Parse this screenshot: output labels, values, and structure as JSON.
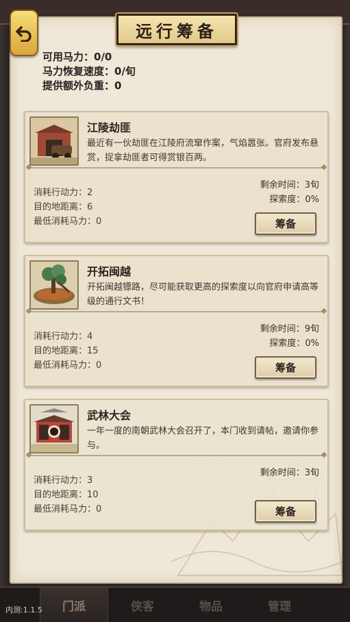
{
  "header": {
    "title": "远行筹备"
  },
  "stats": {
    "available_power": "可用马力：0/0",
    "recovery_speed": "马力恢复速度：0/旬",
    "extra_load": "提供额外负重：0"
  },
  "missions": [
    {
      "name": "江陵劫匪",
      "desc": "最近有一伙劫匪在江陵府流窜作案，气焰嚣张。官府发布悬赏，捉拿劫匪者可得赏银百两。",
      "action_cost": "消耗行动力：2",
      "distance": "目的地距离：6",
      "min_power": "最低消耗马力：0",
      "remaining": "剩余时间：3旬",
      "explore": "探索度：0%",
      "button": "筹备"
    },
    {
      "name": "开拓闽越",
      "desc": "开拓闽越镖路，尽可能获取更高的探索度以向官府申请高等级的通行文书！",
      "action_cost": "消耗行动力：4",
      "distance": "目的地距离：15",
      "min_power": "最低消耗马力：0",
      "remaining": "剩余时间：9旬",
      "explore": "探索度：0%",
      "button": "筹备"
    },
    {
      "name": "武林大会",
      "desc": "一年一度的南朝武林大会召开了，本门收到请帖，邀请你参与。",
      "action_cost": "消耗行动力：3",
      "distance": "目的地距离：10",
      "min_power": "最低消耗马力：0",
      "remaining": "剩余时间：3旬",
      "button": "筹备"
    }
  ],
  "tabs": [
    "门派",
    "侠客",
    "物品",
    "管理"
  ],
  "version": "内测:1.1.5",
  "colors": {
    "paper": "#efe8d8",
    "card": "#ebe2ce",
    "title_plaque": "#f4e4b0",
    "back_button": "#e8c45a"
  }
}
